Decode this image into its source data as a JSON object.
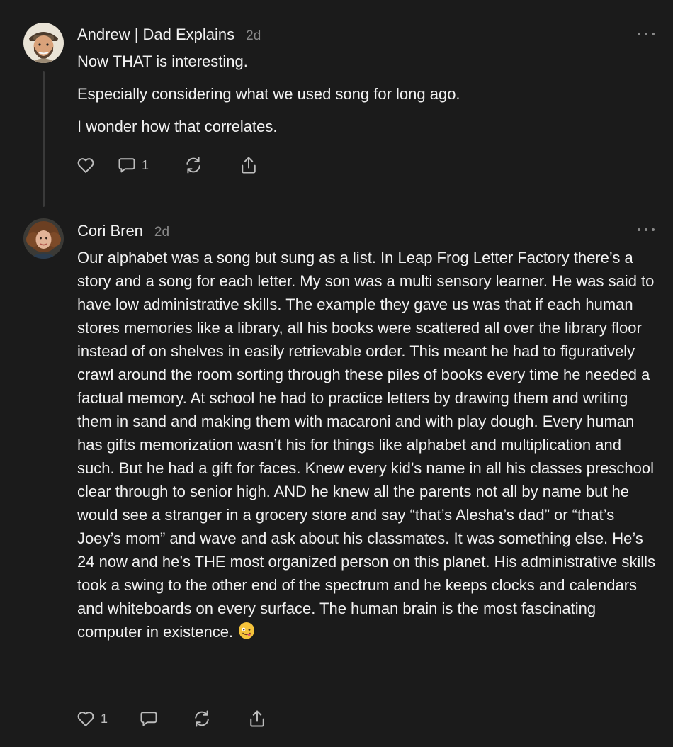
{
  "comments": [
    {
      "author": "Andrew | Dad Explains",
      "time": "2d",
      "paragraphs": [
        "Now THAT is interesting.",
        "Especially considering what we used song for long ago.",
        "I wonder how that correlates."
      ],
      "like_count": "",
      "reply_count": "1",
      "avatar_icon": "illustrated-bearded-man-avatar"
    },
    {
      "author": "Cori Bren",
      "time": "2d",
      "text": "Our alphabet was a song but sung as a list. In Leap Frog Letter Factory there’s a story and a song for each letter. My son was a multi sensory learner. He was said to have low administrative skills. The example they gave us was that if each human stores memories like a library, all his books were scattered all over the library floor instead of on shelves in easily retrievable order. This meant he had to figuratively crawl around the room sorting through these piles of books every time he needed a factual memory. At school he had to practice letters by drawing them and writing them in sand and making them with macaroni and with play dough. Every human has gifts memorization wasn’t his for things like alphabet and multiplication and such. But he had a gift for faces. Knew every kid’s name in all his classes preschool clear through to senior high. AND he knew all the parents not all by name but he would see a stranger in a grocery store and say “that’s Alesha’s dad” or “that’s Joey’s mom” and wave and ask about his classmates. It was something else. He’s 24 now and he’s THE most organized person on this planet. His administrative skills took a swing to the other end of the spectrum and he keeps clocks and calendars and whiteboards on every surface. The human brain is the most fascinating computer in existence.",
      "emoji": "zany-face-emoji",
      "like_count": "1",
      "reply_count": "",
      "avatar_icon": "curly-haired-woman-photo-avatar"
    }
  ],
  "icons": {
    "like": "heart-icon",
    "reply": "comment-bubble-icon",
    "restack": "restack-icon",
    "share": "share-icon",
    "more": "more-options-icon"
  },
  "colors": {
    "background": "#1b1b1b",
    "text": "#f2f2f2",
    "muted": "#8a8a8a",
    "icon": "#bdbdbd"
  }
}
